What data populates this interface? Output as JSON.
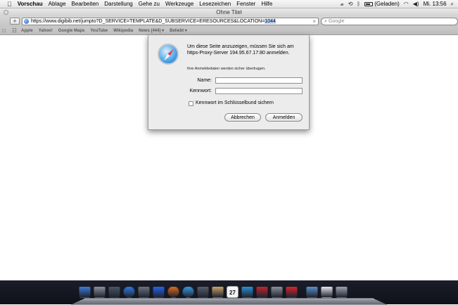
{
  "menubar": {
    "app_name": "Vorschau",
    "items": [
      "Ablage",
      "Bearbeiten",
      "Darstellung",
      "Gehe zu",
      "Werkzeuge",
      "Lesezeichen",
      "Fenster",
      "Hilfe"
    ],
    "battery_status": "(Geladen)",
    "clock": "Mi. 13:56"
  },
  "window": {
    "title": "Ohne Titel",
    "new_tab_label": "+",
    "address_url": "https://www.digibib.net/jumpto?D_SERVICE=TEMPLATE&D_SUBSERVICE=ERESOURCES&LOCATION=",
    "address_url_selected": "1044",
    "address_clear": "×",
    "search_placeholder": "Google"
  },
  "bookmarks": {
    "items": [
      "Apple",
      "Yahoo!",
      "Google Maps",
      "YouTube",
      "Wikipedia",
      "News (444) ▾",
      "Beliebt ▾"
    ]
  },
  "auth_dialog": {
    "message": "Um diese Seite anzuzeigen, müssen Sie sich am https-Proxy-Server 194.95.67.17:80 anmelden.",
    "subtext": "Ihre Anmeldedaten werden sicher übertragen.",
    "name_label": "Name:",
    "name_value": "",
    "password_label": "Kennwort:",
    "password_value": "",
    "remember_label": "Kennwort im Schlüsselbund sichern",
    "remember_checked": false,
    "cancel_label": "Abbrechen",
    "login_label": "Anmelden"
  },
  "dock": {
    "icons": [
      "finder-icon",
      "launchpad-icon",
      "mission-control-icon",
      "app-store-icon",
      "photo-app-icon",
      "preview-icon",
      "firefox-icon",
      "safari-icon",
      "facetime-icon",
      "address-book-icon",
      "calendar-icon",
      "itunes-icon",
      "photo-booth-icon",
      "system-preferences-icon",
      "antivirus-icon",
      "downloads-folder-icon",
      "document-stack-icon",
      "trash-icon"
    ],
    "calendar_day": "27",
    "icon_colors": [
      "#3d7bd9",
      "#8a8f99",
      "#4b5563",
      "#2f7be0",
      "#6b7280",
      "#2563eb",
      "#e36b1c",
      "#3b9ae1",
      "#555e6b",
      "#c9a46b",
      "#f3f4f6",
      "#2b8fd6",
      "#c0262d",
      "#8b8f96",
      "#d9232f",
      "#5b8fc9",
      "#e5e7eb",
      "#9ca3af"
    ]
  }
}
